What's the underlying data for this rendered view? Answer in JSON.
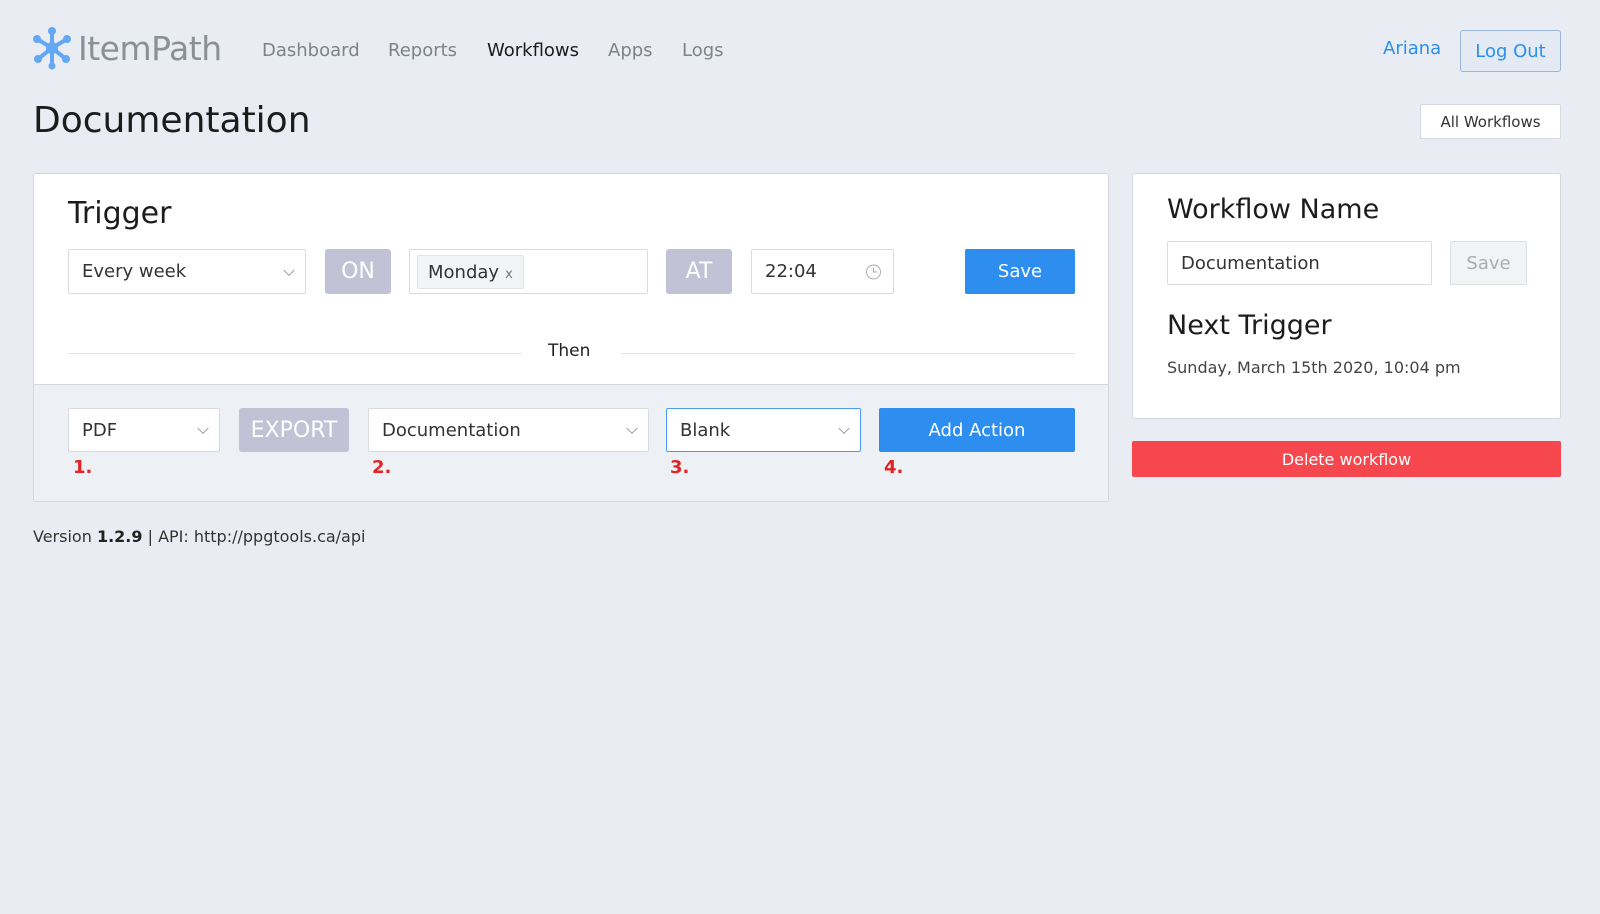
{
  "app": {
    "logo_text": "ItemPath",
    "brand_color": "#62a8f4"
  },
  "nav": {
    "items": [
      {
        "label": "Dashboard",
        "active": false
      },
      {
        "label": "Reports",
        "active": false
      },
      {
        "label": "Workflows",
        "active": true
      },
      {
        "label": "Apps",
        "active": false
      },
      {
        "label": "Logs",
        "active": false
      }
    ]
  },
  "user": {
    "name": "Ariana",
    "logout_label": "Log Out"
  },
  "page": {
    "title": "Documentation",
    "all_workflows_label": "All Workflows"
  },
  "trigger": {
    "title": "Trigger",
    "frequency": "Every week",
    "on_label": "ON",
    "day_tag": "Monday",
    "tag_remove": "x",
    "at_label": "AT",
    "time": "22:04",
    "save_label": "Save",
    "then_label": "Then"
  },
  "action": {
    "format": "PDF",
    "export_label": "EXPORT",
    "source": "Documentation",
    "template": "Blank",
    "add_label": "Add Action",
    "steps": [
      "1.",
      "2.",
      "3.",
      "4."
    ]
  },
  "sidebar": {
    "workflow_name_title": "Workflow Name",
    "workflow_name_value": "Documentation",
    "save_label": "Save",
    "next_trigger_title": "Next Trigger",
    "next_trigger_value": "Sunday, March 15th 2020, 10:04 pm",
    "delete_label": "Delete workflow"
  },
  "footer": {
    "version_prefix": "Version",
    "version": "1.2.9",
    "api_text": "| API: http://ppgtools.ca/api"
  },
  "colors": {
    "primary": "#2d8ef0",
    "danger": "#f5474d",
    "pill": "#c1c2d6",
    "step_marker": "#e02424",
    "background": "#e9ecf2"
  }
}
